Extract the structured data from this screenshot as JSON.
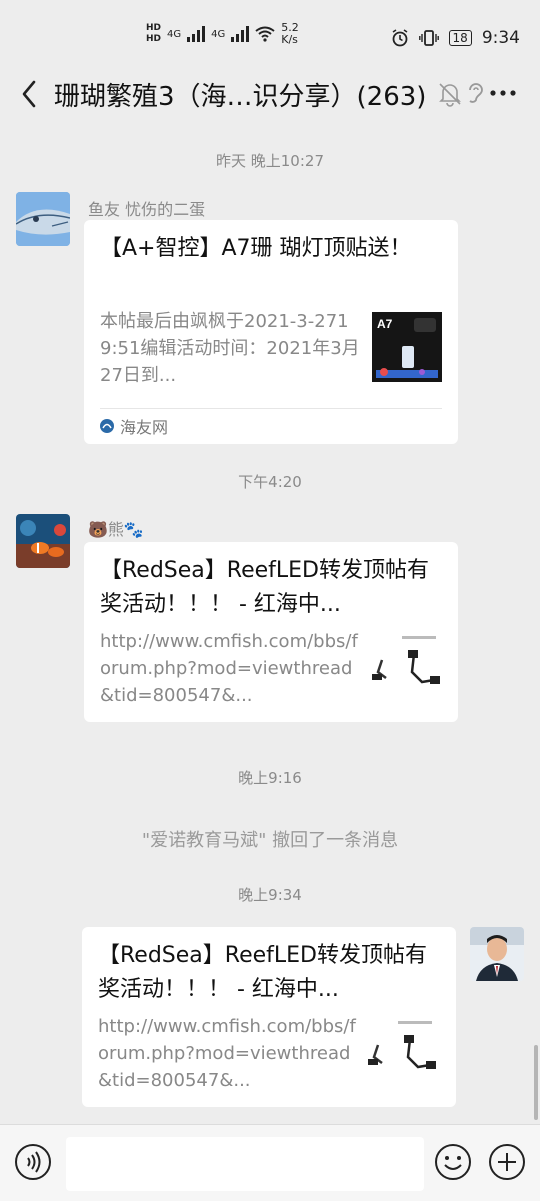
{
  "status": {
    "network": "4G",
    "speed": "5.2",
    "speed_unit": "K/s",
    "battery": "18",
    "time": "9:34"
  },
  "header": {
    "title": "珊瑚繁殖3（海…识分享）(263)"
  },
  "messages": {
    "t1": "昨天 晚上10:27",
    "m1": {
      "sender": "鱼友 忧伤的二蛋",
      "title": "【A+智控】A7珊 瑚灯顶贴送！",
      "desc": "本帖最后由飒枫于2021-3-2719:51编辑活动时间：2021年3月27日到...",
      "source": "海友网",
      "thumb_label": "A7"
    },
    "t2": "下午4:20",
    "m2": {
      "sender": "🐻熊🐾",
      "title": "【RedSea】ReefLED转发顶帖有奖活动！！！ - 红海中...",
      "desc": "http://www.cmfish.com/bbs/forum.php?mod=viewthread&tid=800547&..."
    },
    "t3": "晚上9:16",
    "recall": "\"爱诺教育马斌\" 撤回了一条消息",
    "t4": "晚上9:34",
    "m3": {
      "title": "【RedSea】ReefLED转发顶帖有奖活动！！！ - 红海中...",
      "desc": "http://www.cmfish.com/bbs/forum.php?mod=viewthread&tid=800547&..."
    }
  },
  "input": {
    "placeholder": ""
  },
  "colors": {
    "background": "#ededed",
    "card": "#ffffff",
    "muted_text": "#888888"
  }
}
